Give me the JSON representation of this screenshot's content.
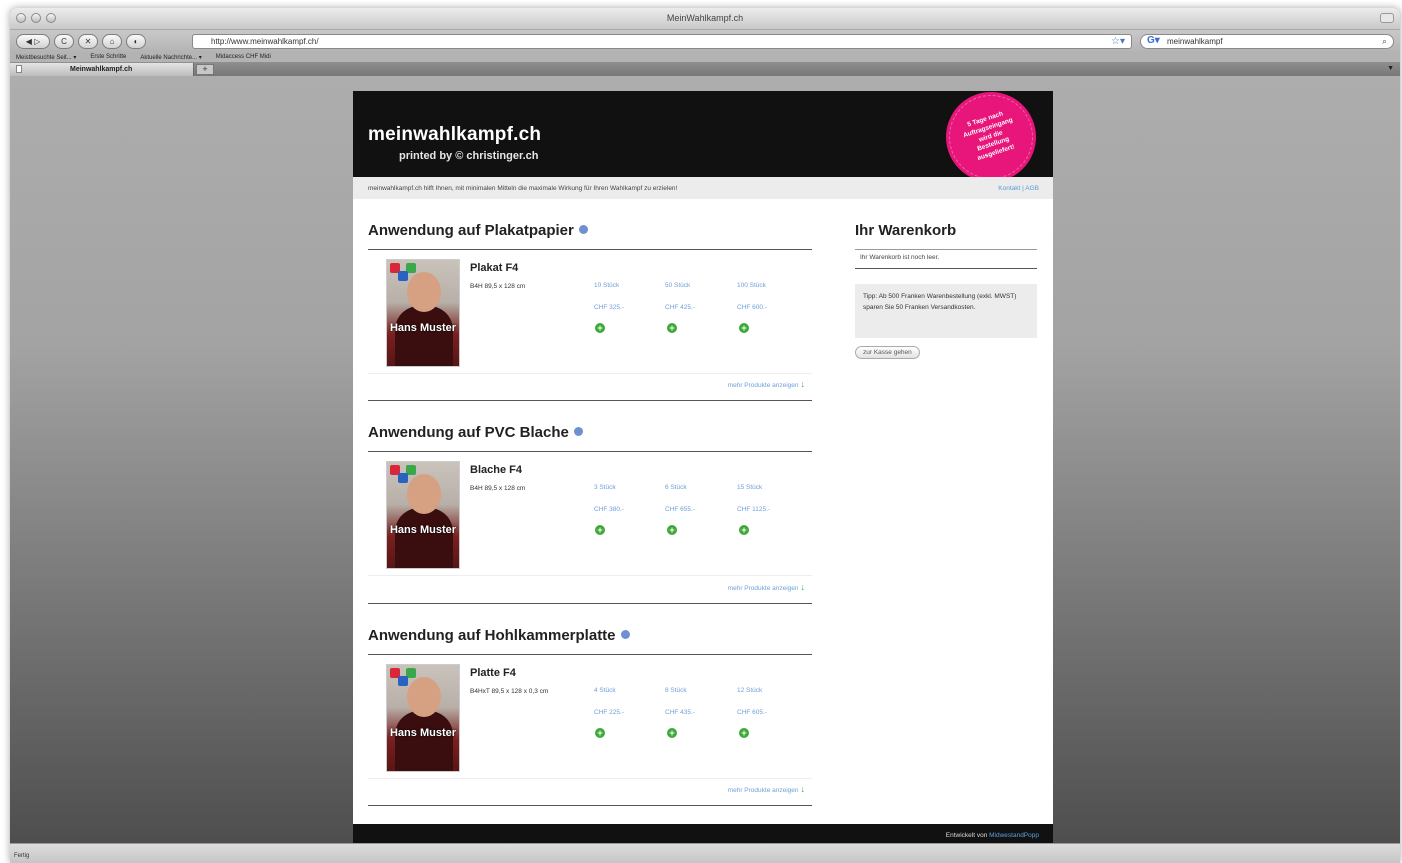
{
  "browser": {
    "window_title": "MeinWahlkampf.ch",
    "url": "http://www.meinwahlkampf.ch/",
    "search_value": "meinwahlkampf",
    "bookmarks": [
      "Meistbesuchte Seit... ▾",
      "Erste Schritte",
      "Aktuelle Nachrichte... ▾",
      "Midaccess CHF Midi"
    ],
    "tab_label": "Meinwahlkampf.ch",
    "status_text": "Fertig"
  },
  "header": {
    "logo": "meinwahlkampf.ch",
    "logo_sub": "printed by © christinger.ch",
    "badge_text": "5 Tage nach Auftragseingang wird die Bestellung ausgeliefert!"
  },
  "infobar": {
    "tagline": "meinwahlkampf.ch hilft Ihnen, mit minimalen Mitteln die maximale Wirkung für Ihren Wahlkampf zu erzielen!",
    "links": "Kontakt | AGB"
  },
  "sections": [
    {
      "title": "Anwendung auf Plakatpapier",
      "product_title": "Plakat F4",
      "product_size": "B4H 89,5 x 128 cm",
      "poster_name": "Hans Muster",
      "options": [
        {
          "qty": "10 Stück",
          "price": "CHF 325.-"
        },
        {
          "qty": "50 Stück",
          "price": "CHF 425.-"
        },
        {
          "qty": "100 Stück",
          "price": "CHF 600.-"
        }
      ],
      "more": "mehr Produkte anzeigen"
    },
    {
      "title": "Anwendung auf PVC Blache",
      "product_title": "Blache F4",
      "product_size": "B4H 89,5 x 128 cm",
      "poster_name": "Hans Muster",
      "options": [
        {
          "qty": "3 Stück",
          "price": "CHF 380.-"
        },
        {
          "qty": "6 Stück",
          "price": "CHF 655.-"
        },
        {
          "qty": "15 Stück",
          "price": "CHF 1125.-"
        }
      ],
      "more": "mehr Produkte anzeigen"
    },
    {
      "title": "Anwendung auf Hohlkammerplatte",
      "product_title": "Platte F4",
      "product_size": "B4HxT 89,5 x 128 x 0,3 cm",
      "poster_name": "Hans Muster",
      "options": [
        {
          "qty": "4 Stück",
          "price": "CHF 225.-"
        },
        {
          "qty": "8 Stück",
          "price": "CHF 435.-"
        },
        {
          "qty": "12 Stück",
          "price": "CHF 605.-"
        }
      ],
      "more": "mehr Produkte anzeigen"
    }
  ],
  "cart": {
    "title": "Ihr Warenkorb",
    "empty_text": "Ihr Warenkorb ist noch leer.",
    "tip": "Tipp: Ab 500 Franken Warenbestellung (exkl. MWST) sparen Sie 50 Franken Versandkosten.",
    "checkout_label": "zur Kasse gehen"
  },
  "footer": {
    "credit_prefix": "Entwickelt von ",
    "credit_link": "MidwestandPopp"
  },
  "colors": {
    "accent_pink": "#e8157a",
    "link_blue": "#6ea0d8",
    "add_green": "#3faa3a"
  }
}
